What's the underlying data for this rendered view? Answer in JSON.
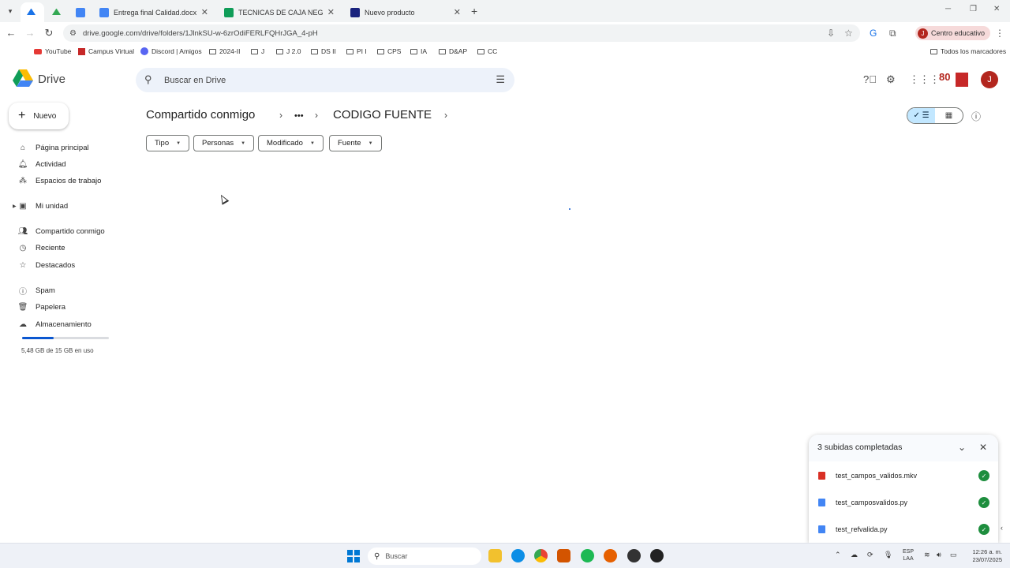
{
  "browser": {
    "tabs": [
      {
        "title": "",
        "favicon_color": "#1a73e8",
        "active": true
      },
      {
        "title": "",
        "favicon_color": "#34a853",
        "active": false
      },
      {
        "title": "",
        "favicon_color": "#4285f4",
        "active": false
      },
      {
        "title": "Entrega final Calidad.docx - Do",
        "favicon_color": "#4285f4",
        "active": false
      },
      {
        "title": "TECNICAS DE CAJA NEGRA Y M",
        "favicon_color": "#0f9d58",
        "active": false
      },
      {
        "title": "Nuevo producto",
        "favicon_color": "#1a237e",
        "active": false
      }
    ],
    "url": "drive.google.com/drive/folders/1JlnkSU-w-6zrOdiFERLFQHrJGA_4-pH",
    "profile_label": "Centro educativo",
    "profile_initial": "J",
    "bookmarks": [
      {
        "label": "YouTube",
        "icon": "youtube-icon"
      },
      {
        "label": "Campus Virtual",
        "icon": "campus-icon"
      },
      {
        "label": "Discord | Amigos",
        "icon": "discord-icon"
      },
      {
        "label": "2024-II",
        "icon": "folder-icon"
      },
      {
        "label": "J",
        "icon": "folder-icon"
      },
      {
        "label": "J 2.0",
        "icon": "folder-icon"
      },
      {
        "label": "DS II",
        "icon": "folder-icon"
      },
      {
        "label": "PI I",
        "icon": "folder-icon"
      },
      {
        "label": "CPS",
        "icon": "folder-icon"
      },
      {
        "label": "IA",
        "icon": "folder-icon"
      },
      {
        "label": "D&AP",
        "icon": "folder-icon"
      },
      {
        "label": "CC",
        "icon": "folder-icon"
      }
    ],
    "all_bookmarks_label": "Todos los marcadores"
  },
  "drive": {
    "app_name": "Drive",
    "search_placeholder": "Buscar en Drive",
    "new_button_label": "Nuevo",
    "user_initial": "J",
    "org_logo_text": "80",
    "nav": [
      {
        "label": "Página principal",
        "icon": "home-icon"
      },
      {
        "label": "Actividad",
        "icon": "bell-icon"
      },
      {
        "label": "Espacios de trabajo",
        "icon": "workspaces-icon"
      },
      {
        "label": "Mi unidad",
        "icon": "drive-icon"
      },
      {
        "label": "Compartido conmigo",
        "icon": "people-icon"
      },
      {
        "label": "Reciente",
        "icon": "clock-icon"
      },
      {
        "label": "Destacados",
        "icon": "star-icon"
      },
      {
        "label": "Spam",
        "icon": "spam-icon"
      },
      {
        "label": "Papelera",
        "icon": "trash-icon"
      },
      {
        "label": "Almacenamiento",
        "icon": "cloud-icon"
      }
    ],
    "storage_text": "5,48 GB de 15 GB en uso",
    "storage_used_fraction": 0.365,
    "breadcrumb": {
      "root": "Compartido conmigo",
      "ellipsis": "•••",
      "current": "CODIGO FUENTE"
    },
    "filters": [
      "Tipo",
      "Personas",
      "Modificado",
      "Fuente"
    ]
  },
  "upload_panel": {
    "title": "3 subidas completadas",
    "files": [
      {
        "name": "test_campos_validos.mkv",
        "icon": "video-file-icon",
        "icon_color": "#d93025",
        "status": "done"
      },
      {
        "name": "test_camposvalidos.py",
        "icon": "doc-file-icon",
        "icon_color": "#4285f4",
        "status": "done"
      },
      {
        "name": "test_refvalida.py",
        "icon": "doc-file-icon",
        "icon_color": "#4285f4",
        "status": "done"
      }
    ]
  },
  "taskbar": {
    "search_placeholder": "Buscar",
    "lang_line1": "ESP",
    "lang_line2": "LAA",
    "time": "12:26 a. m.",
    "date": "23/07/2025"
  }
}
